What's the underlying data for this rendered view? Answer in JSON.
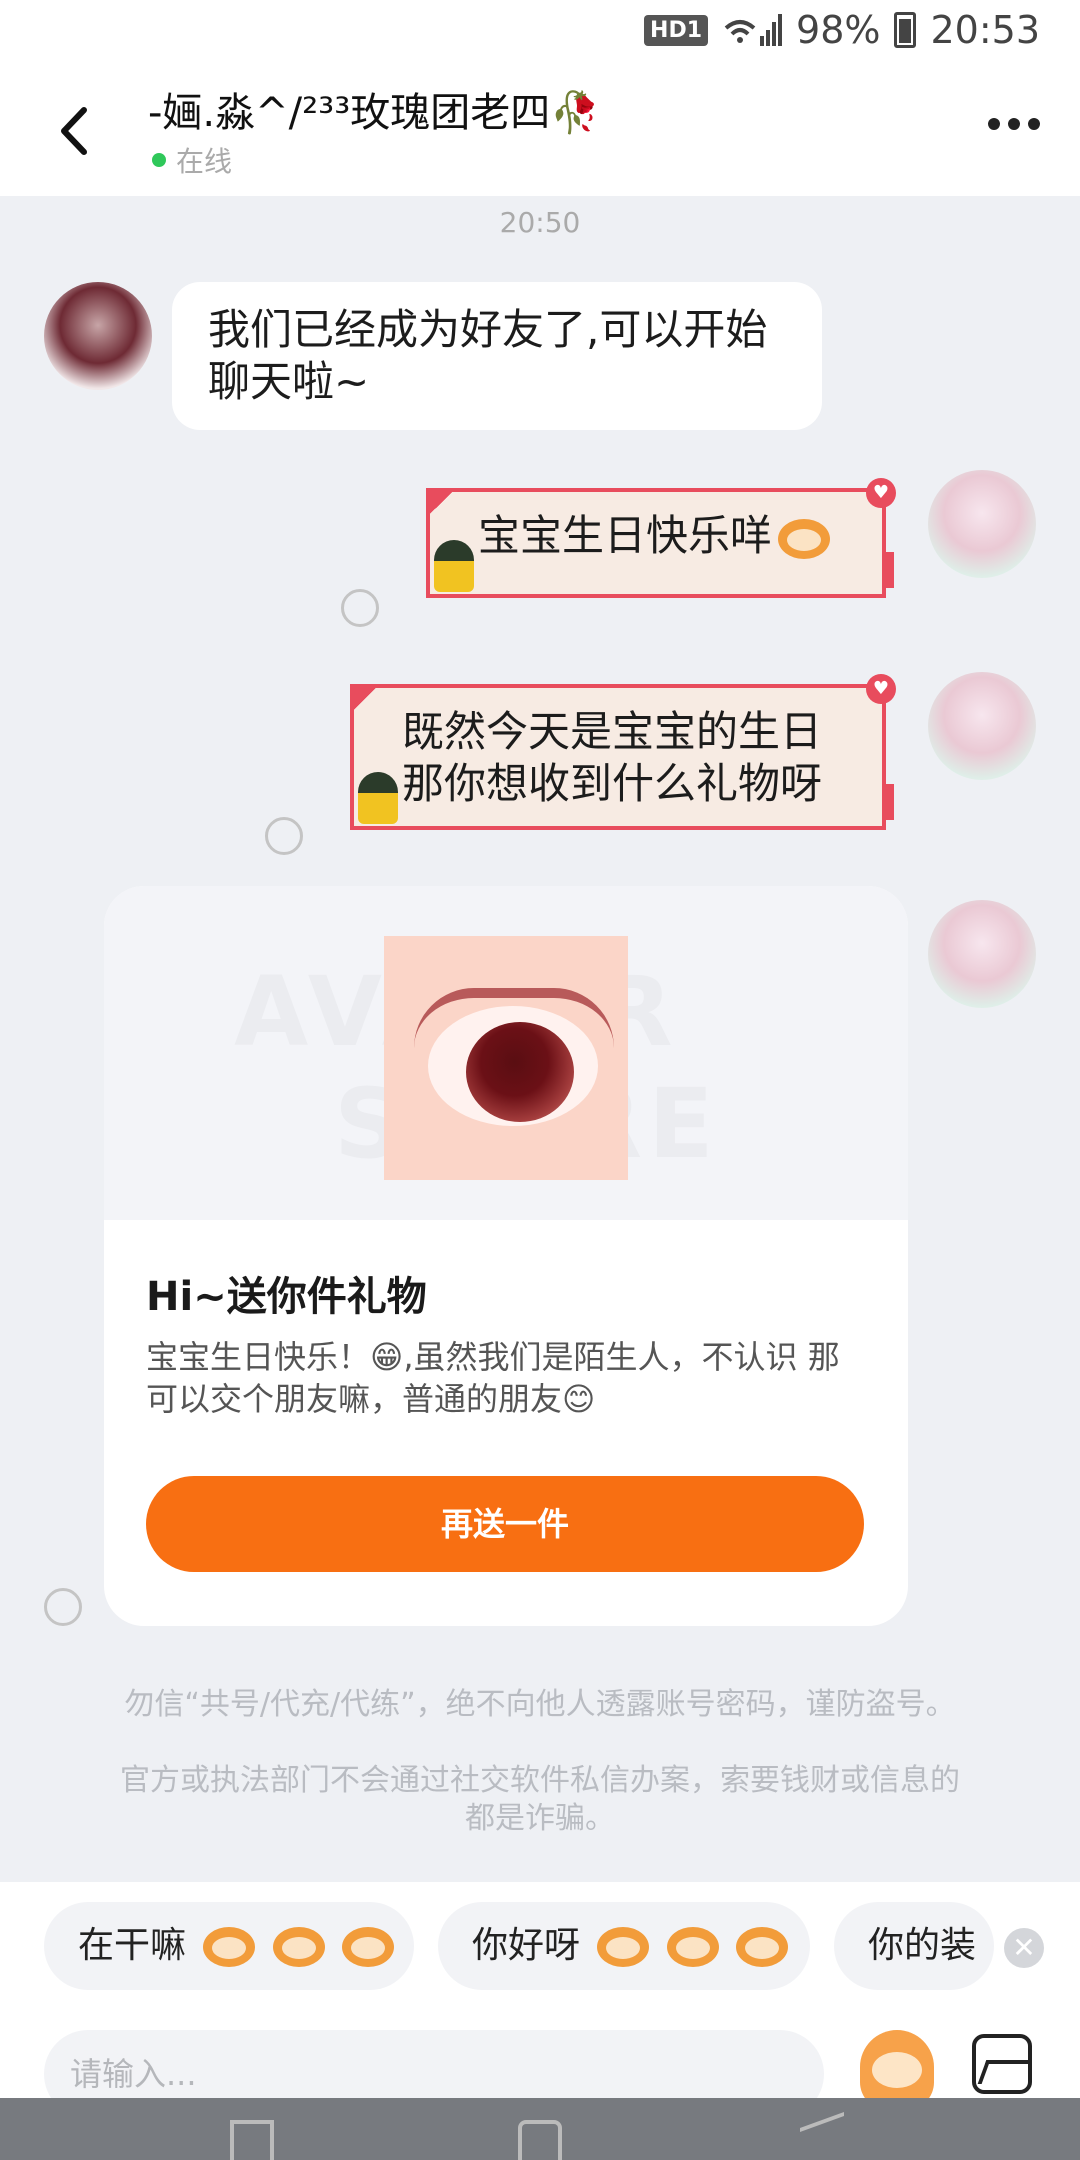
{
  "status_bar": {
    "hd": "HD1",
    "network": "4G",
    "battery": "98%",
    "time": "20:53"
  },
  "header": {
    "title": "-婳.淼^/²³³玫瑰团老四🥀",
    "status": "在线"
  },
  "chat": {
    "timestamp": "20:50",
    "friend_message": {
      "line1": "我们已经成为好友了,可以开始",
      "line2": "聊天啦~"
    },
    "my_message_1": "宝宝生日快乐咩",
    "my_message_2": {
      "line1": "既然今天是宝宝的生日",
      "line2": "那你想收到什么礼物呀"
    }
  },
  "gift_card": {
    "watermark_line1": "AVATAR",
    "watermark_line2": "STORE",
    "title": "Hi~送你件礼物",
    "desc_line1": "宝宝生日快乐！😁,虽然我们是陌生人，不认识 那",
    "desc_line2": "可以交个朋友嘛，普通的朋友😊",
    "button": "再送一件"
  },
  "notices": {
    "line1": "勿信“共号/代充/代练”，绝不向他人透露账号密码，谨防盗号。",
    "line2a": "官方或执法部门不会通过社交软件私信办案，索要钱财或信息的",
    "line2b": "都是诈骗。"
  },
  "quick_replies": [
    {
      "label": "在干嘛"
    },
    {
      "label": "你好呀"
    },
    {
      "label": "你的装"
    }
  ],
  "input": {
    "placeholder": "请输入..."
  },
  "colors": {
    "accent": "#f86f12",
    "online": "#2fc85a",
    "bubble_border": "#e84c5d"
  }
}
